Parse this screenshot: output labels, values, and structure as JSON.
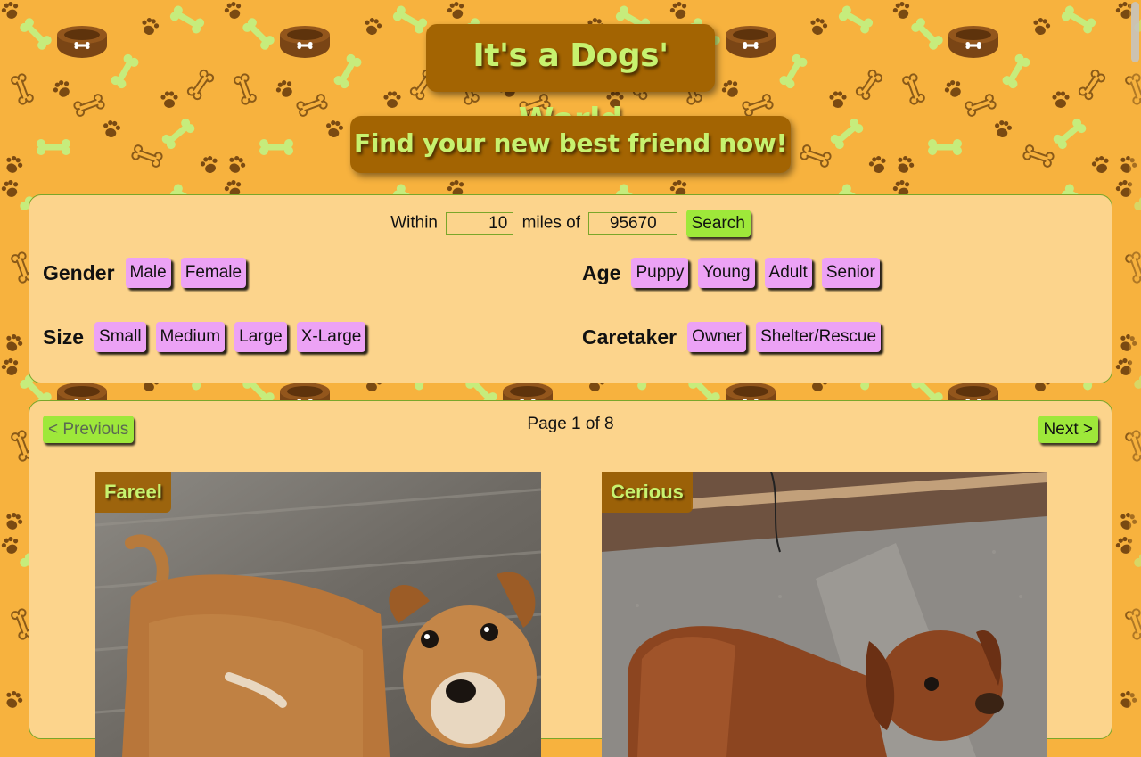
{
  "header": {
    "title": "It's a Dogs' World",
    "subtitle": "Find your new best friend now!"
  },
  "search": {
    "within_label": "Within",
    "radius_value": "10",
    "miles_label": "miles of",
    "zip_value": "95670",
    "search_button": "Search"
  },
  "filters": {
    "gender": {
      "label": "Gender",
      "options": [
        "Male",
        "Female"
      ]
    },
    "age": {
      "label": "Age",
      "options": [
        "Puppy",
        "Young",
        "Adult",
        "Senior"
      ]
    },
    "size": {
      "label": "Size",
      "options": [
        "Small",
        "Medium",
        "Large",
        "X-Large"
      ]
    },
    "caretaker": {
      "label": "Caretaker",
      "options": [
        "Owner",
        "Shelter/Rescue"
      ]
    }
  },
  "pagination": {
    "previous": "< Previous",
    "next": "Next >",
    "page_text": "Page 1 of 8"
  },
  "results": [
    {
      "name": "Fareel"
    },
    {
      "name": "Cerious"
    }
  ],
  "colors": {
    "background": "#f7b23e",
    "title_box": "#a36402",
    "title_text": "#c7f26f",
    "panel": "#fcd48c",
    "green_button": "#9ee83a",
    "chip": "#eca2f5"
  },
  "icons": {
    "background_pattern": [
      "bone-icon",
      "paw-icon",
      "dog-bowl-icon"
    ]
  }
}
